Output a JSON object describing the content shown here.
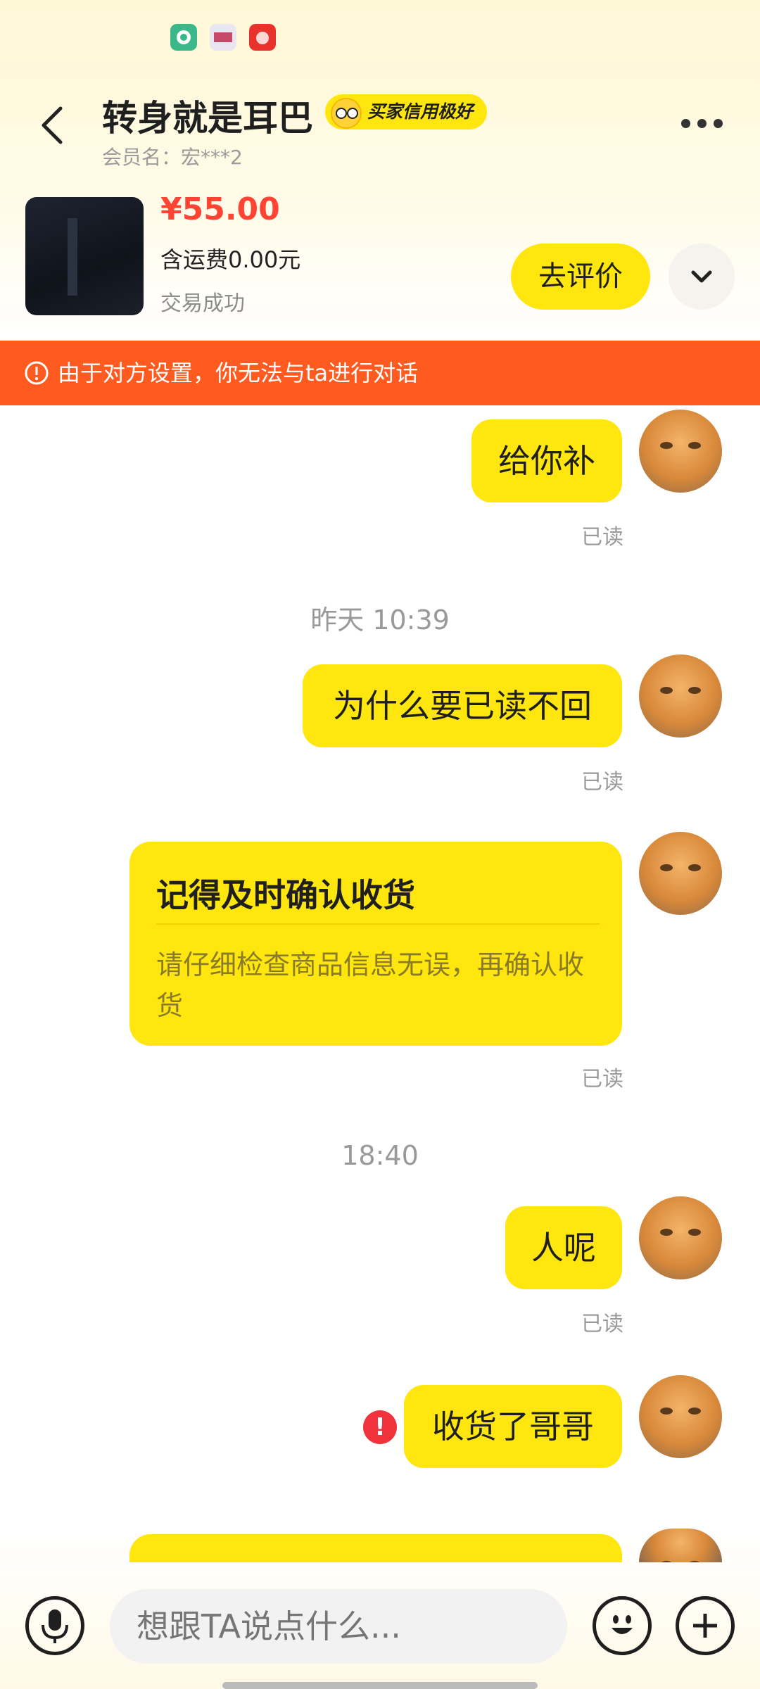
{
  "status_bar": {
    "app_icons": [
      "green-app-icon",
      "gallery-app-icon",
      "red-app-icon"
    ]
  },
  "header": {
    "title": "转身就是耳巴",
    "badge": "买家信用极好",
    "member": "会员名：宏***2"
  },
  "product": {
    "price": "¥55.00",
    "shipping": "含运费0.00元",
    "status": "交易成功",
    "review_button": "去评价"
  },
  "warning": {
    "text": "由于对方设置，你无法与ta进行对话"
  },
  "messages": {
    "m1": {
      "text": "给你补",
      "read": "已读"
    },
    "ts1": "昨天 10:39",
    "m2": {
      "text": "为什么要已读不回",
      "read": "已读"
    },
    "card": {
      "title": "记得及时确认收货",
      "body": "请仔细检查商品信息无误，再确认收货",
      "read": "已读"
    },
    "ts2": "18:40",
    "m3": {
      "text": "人呢",
      "read": "已读"
    },
    "m4": {
      "text": "收货了哥哥",
      "error_icon": "!"
    }
  },
  "input": {
    "placeholder": "想跟TA说点什么..."
  },
  "colors": {
    "accent": "#ffe60f",
    "warning": "#ff5a1f",
    "price": "#ff4433",
    "error": "#f0323c"
  }
}
